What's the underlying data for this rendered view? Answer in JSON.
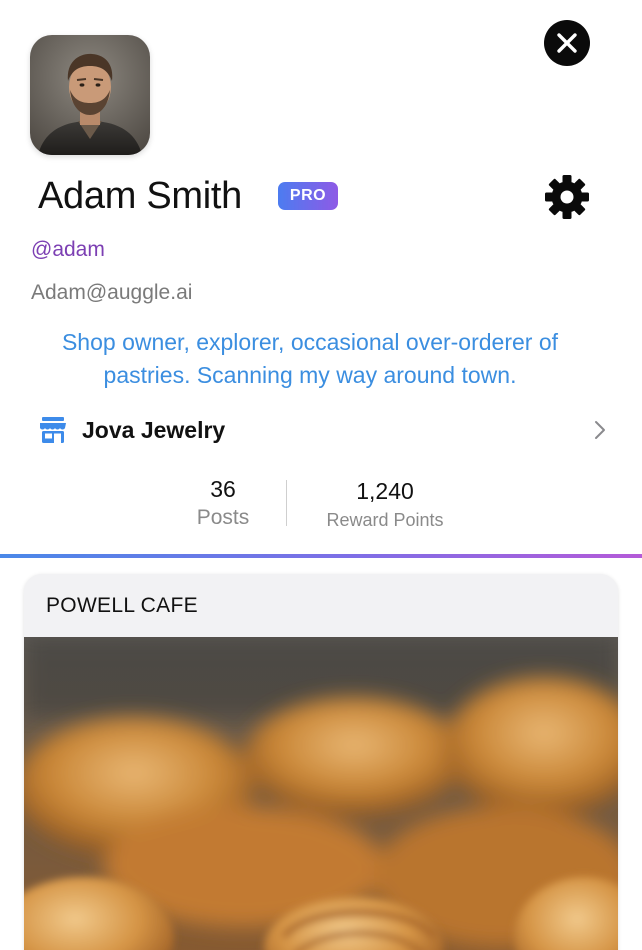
{
  "header": {
    "close_icon": "close-icon"
  },
  "profile": {
    "avatar_icon": "avatar-photo",
    "name": "Adam Smith",
    "badge": "PRO",
    "settings_icon": "gear-icon",
    "handle": "@adam",
    "email": "Adam@auggle.ai",
    "bio": "Shop owner, explorer, occasional over-orderer of pastries. Scanning my way around town."
  },
  "shop": {
    "icon": "storefront-icon",
    "name": "Jova Jewelry",
    "chevron_icon": "chevron-right-icon"
  },
  "stats": {
    "posts": {
      "value": "36",
      "label": "Posts"
    },
    "points": {
      "value": "1,240",
      "label": "Reward Points"
    }
  },
  "post": {
    "title": "POWELL CAFE",
    "image": "croissants-photo"
  },
  "colors": {
    "handle": "#7c3fb3",
    "bio": "#3b8ee0",
    "shop_icon": "#3d8bea",
    "badge_start": "#4c7cf0",
    "badge_end": "#8e5ae6",
    "separator_start": "#4a88e8",
    "separator_end": "#b45ad8"
  }
}
